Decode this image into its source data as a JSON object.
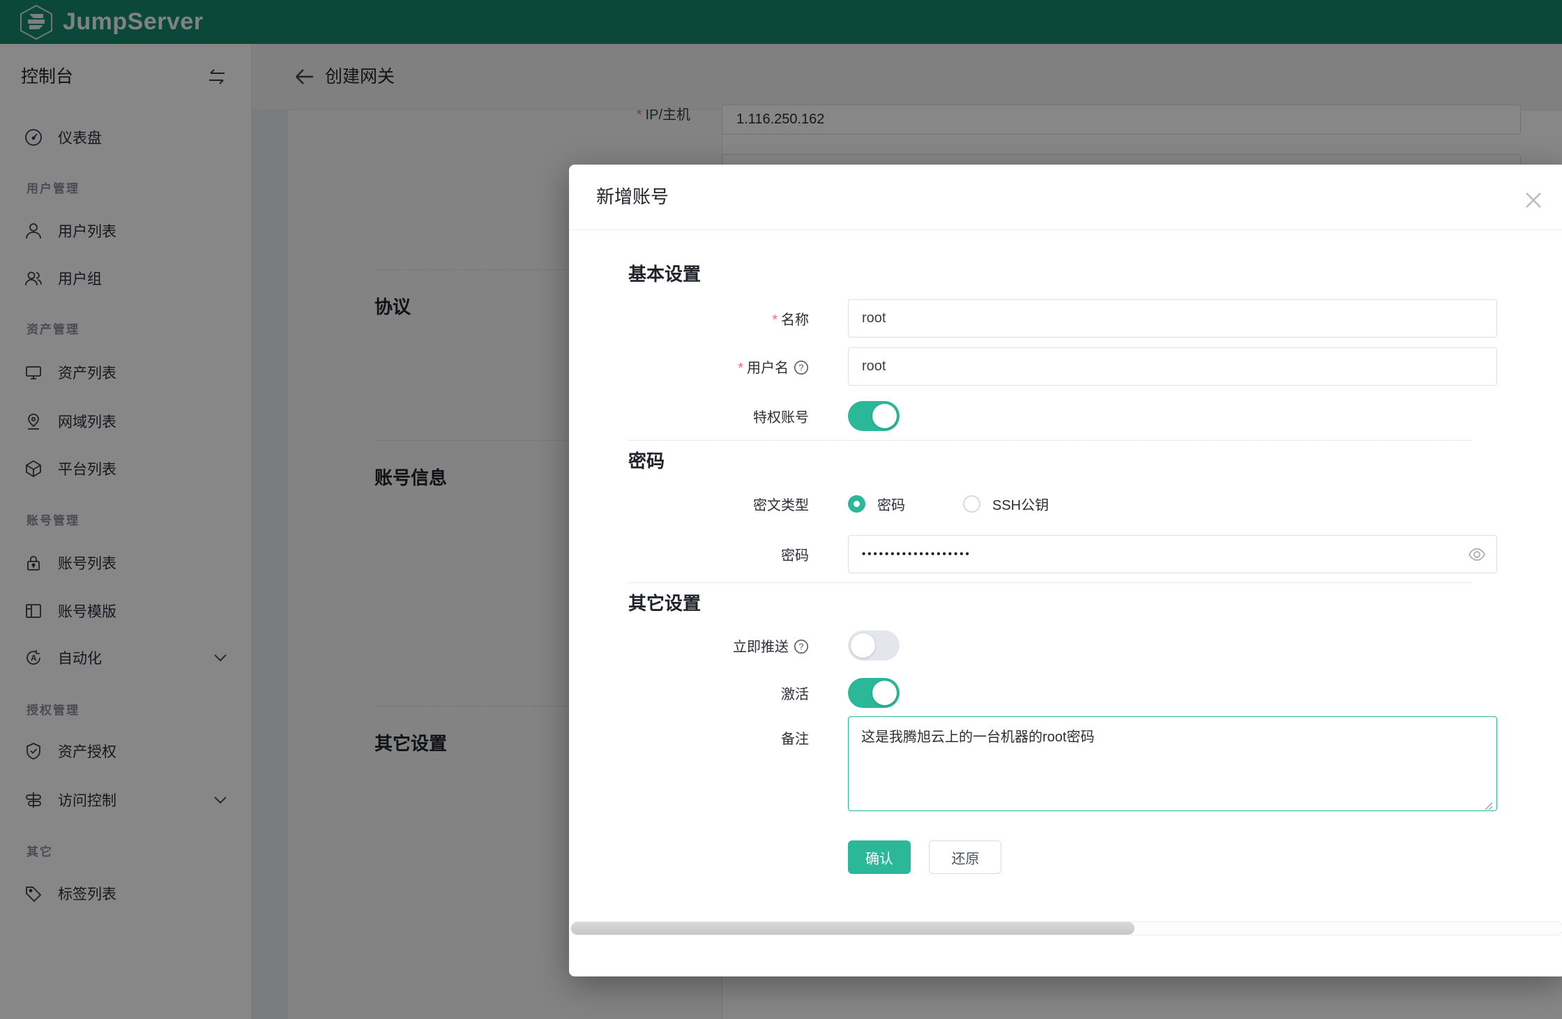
{
  "topbar": {
    "brand": "JumpServer"
  },
  "sidebar": {
    "title": "控制台",
    "sections": [
      {
        "items": [
          {
            "icon": "gauge-icon",
            "label": "仪表盘"
          }
        ]
      },
      {
        "header": "用户管理",
        "items": [
          {
            "icon": "user-icon",
            "label": "用户列表"
          },
          {
            "icon": "users-icon",
            "label": "用户组"
          }
        ]
      },
      {
        "header": "资产管理",
        "items": [
          {
            "icon": "monitor-icon",
            "label": "资产列表"
          },
          {
            "icon": "map-pin-icon",
            "label": "网域列表"
          },
          {
            "icon": "cube-icon",
            "label": "平台列表"
          }
        ]
      },
      {
        "header": "账号管理",
        "items": [
          {
            "icon": "lock-icon",
            "label": "账号列表"
          },
          {
            "icon": "template-icon",
            "label": "账号模版"
          },
          {
            "icon": "automation-icon",
            "label": "自动化",
            "expandable": true
          }
        ]
      },
      {
        "header": "授权管理",
        "items": [
          {
            "icon": "shield-check-icon",
            "label": "资产授权"
          },
          {
            "icon": "access-control-icon",
            "label": "访问控制",
            "expandable": true
          }
        ]
      },
      {
        "header": "其它",
        "items": [
          {
            "icon": "tag-icon",
            "label": "标签列表"
          }
        ]
      }
    ]
  },
  "page": {
    "title": "创建网关",
    "required_marker": "*",
    "background_form": {
      "ip_label": "IP/主机",
      "ip_value": "1.116.250.162",
      "section_protocol": "协议",
      "section_account": "账号信息",
      "section_other": "其它设置"
    }
  },
  "modal": {
    "title": "新增账号",
    "basic": {
      "heading": "基本设置",
      "name_label": "名称",
      "name_value": "root",
      "username_label": "用户名",
      "username_value": "root",
      "privileged_label": "特权账号",
      "privileged_on": true
    },
    "secret": {
      "heading": "密码",
      "type_label": "密文类型",
      "option_password": "密码",
      "option_ssh": "SSH公钥",
      "selected_option": "密码",
      "password_label": "密码",
      "password_mask": "•••••••••••••••••••"
    },
    "other": {
      "heading": "其它设置",
      "push_label": "立即推送",
      "push_on": false,
      "active_label": "激活",
      "active_on": true,
      "comment_label": "备注",
      "comment_value": "这是我腾旭云上的一台机器的root密码"
    },
    "buttons": {
      "confirm": "确认",
      "reset": "还原"
    }
  },
  "colors": {
    "brand_green": "#15886e",
    "accent_green": "#2ab898",
    "danger_red": "#f56c6c"
  }
}
